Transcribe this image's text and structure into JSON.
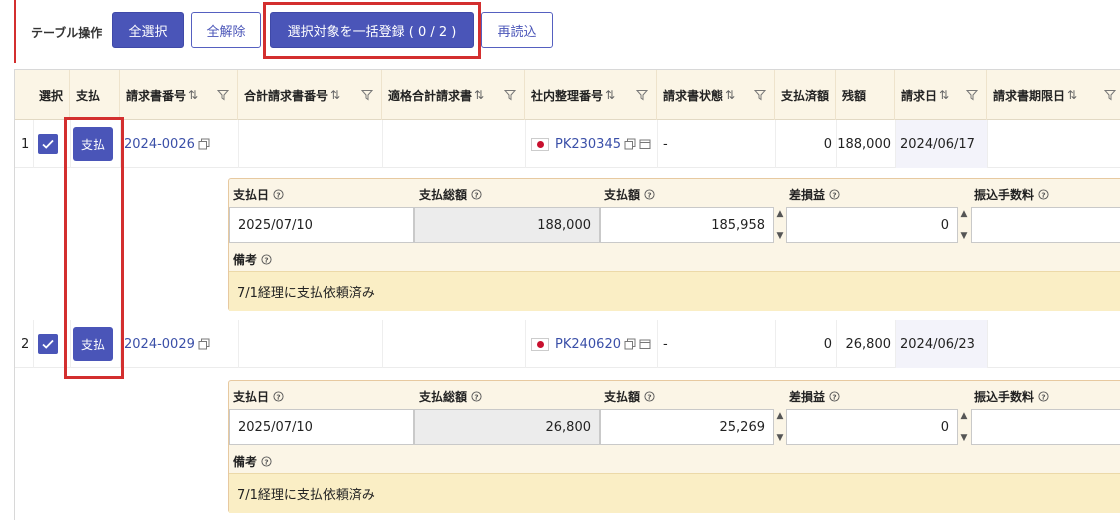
{
  "toolbar": {
    "label": "テーブル操作",
    "select_all": "全選択",
    "deselect_all": "全解除",
    "bulk_register": "選択対象を一括登録 ( 0 / 2 )",
    "reload": "再読込"
  },
  "table": {
    "headers": {
      "select": "選択",
      "pay": "支払",
      "invoice_no": "請求書番号",
      "total_invoice_no": "合計請求書番号",
      "qualified_invoice": "適格合計請求書",
      "internal_no": "社内整理番号",
      "status": "請求書状態",
      "paid": "支払済額",
      "balance": "残額",
      "invoice_date": "請求日",
      "due_date": "請求書期限日"
    },
    "rows": [
      {
        "num": "1",
        "pay_label": "支払",
        "invoice_no": "2024-0026",
        "internal_no": "PK230345",
        "status": "-",
        "paid": "0",
        "balance": "188,000",
        "invoice_date": "2024/06/17",
        "detail": {
          "pay_date_label": "支払日",
          "total_label": "支払総額",
          "amount_label": "支払額",
          "diff_label": "差損益",
          "fee_label": "振込手数料",
          "pay_date": "2025/07/10",
          "total": "188,000",
          "amount": "185,958",
          "diff": "0",
          "note_label": "備考",
          "note": "7/1経理に支払依頼済み"
        }
      },
      {
        "num": "2",
        "pay_label": "支払",
        "invoice_no": "2024-0029",
        "internal_no": "PK240620",
        "status": "-",
        "paid": "0",
        "balance": "26,800",
        "invoice_date": "2024/06/23",
        "detail": {
          "pay_date_label": "支払日",
          "total_label": "支払総額",
          "amount_label": "支払額",
          "diff_label": "差損益",
          "fee_label": "振込手数料",
          "pay_date": "2025/07/10",
          "total": "26,800",
          "amount": "25,269",
          "diff": "0",
          "note_label": "備考",
          "note": "7/1経理に支払依頼済み"
        }
      }
    ]
  },
  "colors": {
    "primary": "#4a55b8",
    "highlight": "#d32f2f",
    "header_bg": "#fbf5e6",
    "note_bg": "#faeec5"
  }
}
